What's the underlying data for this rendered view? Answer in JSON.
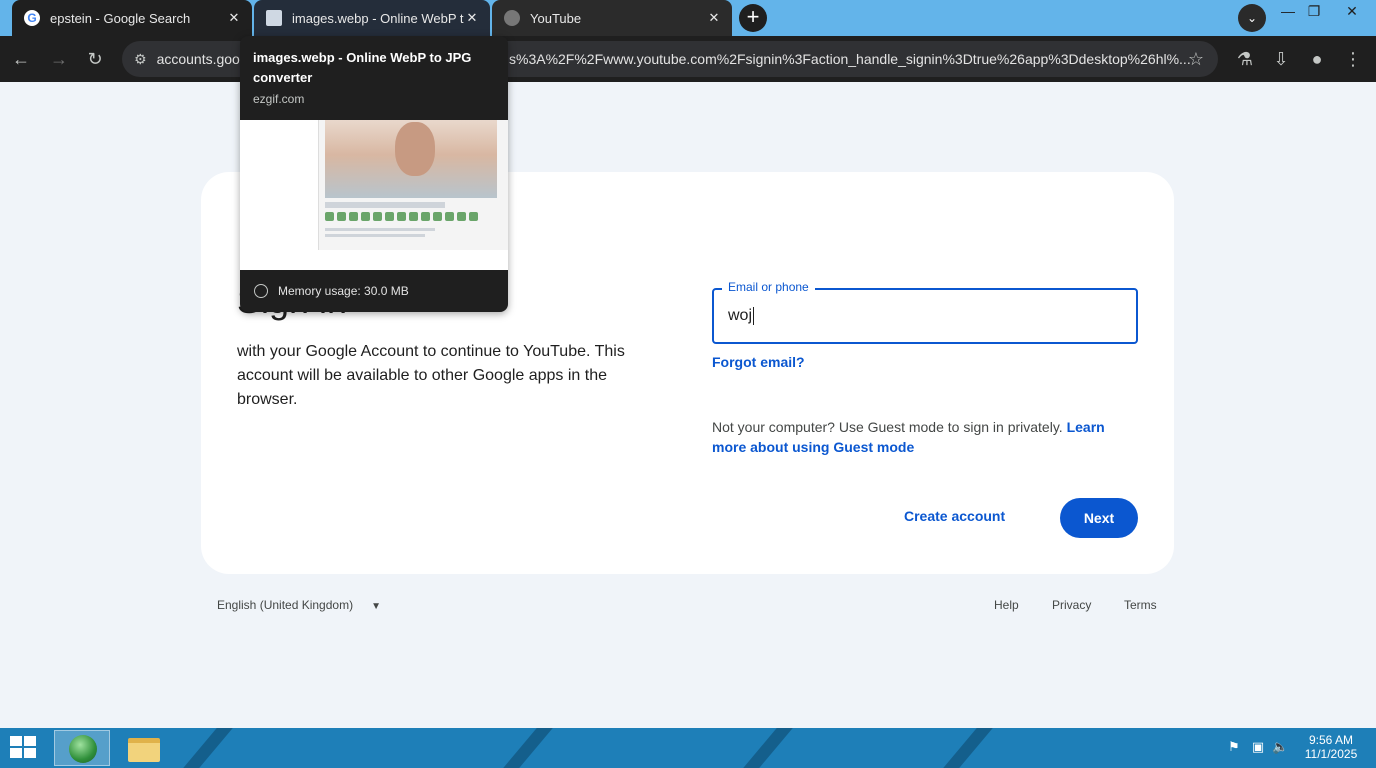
{
  "browser": {
    "tabs": [
      {
        "title": "epstein - Google Search",
        "favicon": "google-g-icon"
      },
      {
        "title": "images.webp - Online WebP to JPG converter",
        "favicon": "ezgif-icon"
      },
      {
        "title": "YouTube",
        "favicon": "globe-icon"
      }
    ],
    "newtab": "+",
    "url_visible_start": "accounts.goog",
    "url_visible_end": "s%3A%2F%2Fwww.youtube.com%2Fsignin%3Faction_handle_signin%3Dtrue%26app%3Ddesktop%26hl%...",
    "hovercard": {
      "title": "images.webp - Online WebP to JPG converter",
      "domain": "ezgif.com",
      "memory": "Memory usage: 30.0 MB"
    }
  },
  "signin": {
    "heading": "Sign in",
    "subtext": "with your Google Account to continue to YouTube. This account will be available to other Google apps in the browser.",
    "email_label": "Email or phone",
    "email_value": "woj",
    "forgot": "Forgot email?",
    "guest_text": "Not your computer? Use Guest mode to sign in privately.",
    "guest_link": "Learn more about using Guest mode",
    "create_account": "Create account",
    "next": "Next"
  },
  "footer": {
    "language": "English (United Kingdom)",
    "help": "Help",
    "privacy": "Privacy",
    "terms": "Terms"
  },
  "taskbar": {
    "time": "9:56 AM",
    "date": "11/1/2025"
  },
  "colors": {
    "accent": "#0b57d0",
    "page_bg": "#f0f4f9",
    "taskbar": "#1e7fb8",
    "tabbar": "#63b4ea"
  }
}
